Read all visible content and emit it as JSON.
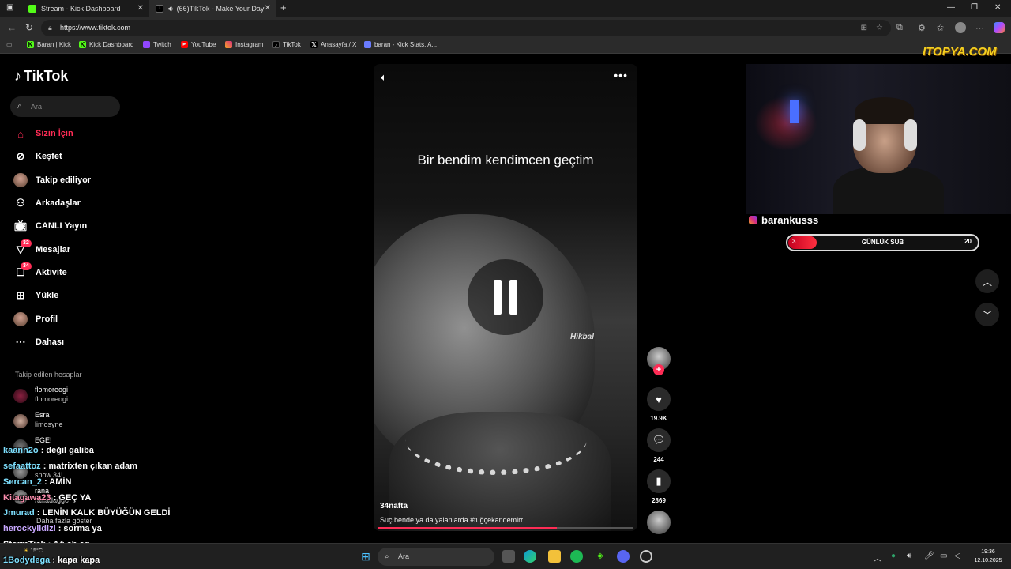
{
  "browser": {
    "tabs": [
      {
        "label": "Stream - Kick Dashboard",
        "favicon_color": "#53fc18"
      },
      {
        "label": "(66)TikTok - Make Your Day",
        "favicon_color": "#000000"
      }
    ],
    "new_tab": "+",
    "url": "https://www.tiktok.com",
    "bookmarks": [
      {
        "label": "Baran | Kick",
        "icon": "kick-icon",
        "color": "#53fc18"
      },
      {
        "label": "Kick Dashboard",
        "icon": "kick-icon",
        "color": "#53fc18"
      },
      {
        "label": "Twitch",
        "icon": "twitch-icon",
        "color": "#9146ff"
      },
      {
        "label": "YouTube",
        "icon": "youtube-icon",
        "color": "#ff0000"
      },
      {
        "label": "Instagram",
        "icon": "instagram-icon",
        "color": "#d92e7f"
      },
      {
        "label": "TikTok",
        "icon": "tiktok-icon",
        "color": "#000000"
      },
      {
        "label": "Anasayfa / X",
        "icon": "x-icon",
        "color": "#000000"
      },
      {
        "label": "baran - Kick Stats, A...",
        "icon": "stats-icon",
        "color": "#6a7cff"
      }
    ]
  },
  "tiktok": {
    "logo": "TikTok",
    "search_placeholder": "Ara",
    "accent": "#fe2c55",
    "nav": [
      {
        "label": "Sizin İçin",
        "icon": "home-icon",
        "active": true
      },
      {
        "label": "Keşfet",
        "icon": "compass-icon"
      },
      {
        "label": "Takip ediliyor",
        "icon": "following-avatar-icon"
      },
      {
        "label": "Arkadaşlar",
        "icon": "friends-icon"
      },
      {
        "label": "CANLI Yayın",
        "icon": "live-icon"
      },
      {
        "label": "Mesajlar",
        "icon": "messages-icon",
        "badge": "32"
      },
      {
        "label": "Aktivite",
        "icon": "activity-icon",
        "badge": "34"
      },
      {
        "label": "Yükle",
        "icon": "upload-icon"
      },
      {
        "label": "Profil",
        "icon": "profile-avatar-icon"
      },
      {
        "label": "Dahası",
        "icon": "more-dots-icon"
      }
    ],
    "following_heading": "Takip edilen hesaplar",
    "following": [
      {
        "name": "flomoreogi",
        "handle": "flomoreogi"
      },
      {
        "name": "Esra",
        "handle": "limosyne"
      },
      {
        "name": "EGE!",
        "handle": ""
      },
      {
        "name": "",
        "handle": "snow.34!"
      },
      {
        "name": "rana",
        "handle": "ranadaggo"
      }
    ],
    "show_more": "Daha fazla göster",
    "video": {
      "caption": "Bir bendim kendimcen geçtim",
      "author": "34nafta",
      "description": "Suç bende ya da yalanlarda  #tuğçekandemirr",
      "overlay_tag": "Hikbal",
      "progress": 0.7
    },
    "actions": {
      "likes": "19.9K",
      "comments": "244",
      "saves": "2869"
    }
  },
  "stream": {
    "watermark": "ITOPYA.COM",
    "streamer": "barankusss",
    "sub_goal": {
      "label": "GÜNLÜK SUB",
      "current": "3",
      "goal": "20",
      "fraction": 0.15
    },
    "chat": [
      {
        "user": "kaann2o",
        "text": " : değil galiba",
        "color": "#7ee0ff"
      },
      {
        "user": "sefaattoz",
        "text": " : matrixten çıkan adam",
        "color": "#7ee0ff"
      },
      {
        "user": "Sercan_2",
        "text": " : AMİN",
        "color": "#7ee0ff"
      },
      {
        "user": "Kitagawa23",
        "text": " : GEÇ YA",
        "color": "#ff8fb0"
      },
      {
        "user": "Jmurad",
        "text": " : LENİN KALK BÜYÜĞÜN GELDİ",
        "color": "#7ee0ff"
      },
      {
        "user": "herockyildizi",
        "text": " : sorma ya",
        "color": "#c8a8ff"
      },
      {
        "user": "StormTick",
        "text": " : Ağ ah ag",
        "color": "#ffffff"
      },
      {
        "user": "1Bodydega",
        "text": " : kapa kapa",
        "color": "#7ee0ff"
      }
    ]
  },
  "taskbar": {
    "search_placeholder": "Ara",
    "weather": "15°C",
    "time": "19:36",
    "date": "12.10.2025"
  }
}
